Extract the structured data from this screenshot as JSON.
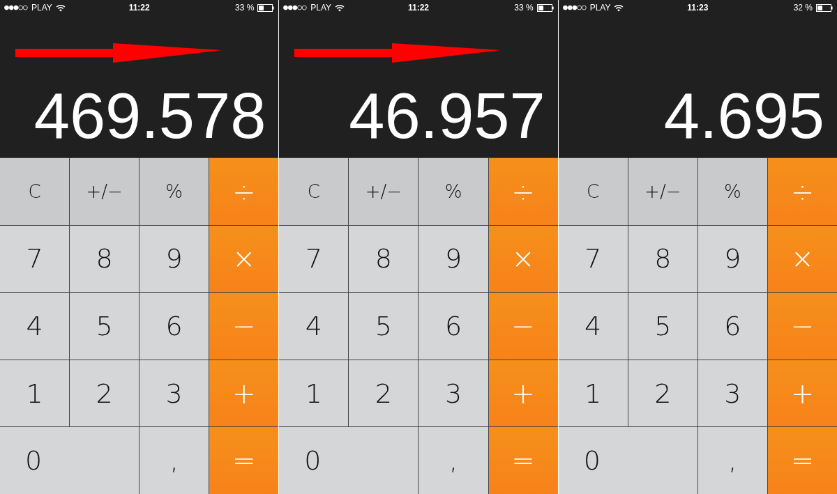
{
  "panels": [
    {
      "status_bar": {
        "carrier": "PLAY",
        "time": "11:22",
        "battery": "33 %"
      },
      "display": "469.578",
      "arrow_overlay": true,
      "keys": [
        {
          "label": "C",
          "kind": "function"
        },
        {
          "label": "+/−",
          "kind": "function"
        },
        {
          "label": "%",
          "kind": "function"
        },
        {
          "label": "÷",
          "kind": "operator"
        },
        {
          "label": "7",
          "kind": "digit"
        },
        {
          "label": "8",
          "kind": "digit"
        },
        {
          "label": "9",
          "kind": "digit"
        },
        {
          "label": "×",
          "kind": "operator"
        },
        {
          "label": "4",
          "kind": "digit"
        },
        {
          "label": "5",
          "kind": "digit"
        },
        {
          "label": "6",
          "kind": "digit"
        },
        {
          "label": "−",
          "kind": "operator"
        },
        {
          "label": "1",
          "kind": "digit"
        },
        {
          "label": "2",
          "kind": "digit"
        },
        {
          "label": "3",
          "kind": "digit"
        },
        {
          "label": "+",
          "kind": "operator"
        },
        {
          "label": "0",
          "kind": "wide"
        },
        {
          "label": ",",
          "kind": "digit"
        },
        {
          "label": "=",
          "kind": "operator"
        }
      ]
    },
    {
      "status_bar": {
        "carrier": "PLAY",
        "time": "11:22",
        "battery": "33 %"
      },
      "display": "46.957",
      "arrow_overlay": true,
      "keys": [
        {
          "label": "C",
          "kind": "function"
        },
        {
          "label": "+/−",
          "kind": "function"
        },
        {
          "label": "%",
          "kind": "function"
        },
        {
          "label": "÷",
          "kind": "operator"
        },
        {
          "label": "7",
          "kind": "digit"
        },
        {
          "label": "8",
          "kind": "digit"
        },
        {
          "label": "9",
          "kind": "digit"
        },
        {
          "label": "×",
          "kind": "operator"
        },
        {
          "label": "4",
          "kind": "digit"
        },
        {
          "label": "5",
          "kind": "digit"
        },
        {
          "label": "6",
          "kind": "digit"
        },
        {
          "label": "−",
          "kind": "operator"
        },
        {
          "label": "1",
          "kind": "digit"
        },
        {
          "label": "2",
          "kind": "digit"
        },
        {
          "label": "3",
          "kind": "digit"
        },
        {
          "label": "+",
          "kind": "operator"
        },
        {
          "label": "0",
          "kind": "wide"
        },
        {
          "label": ",",
          "kind": "digit"
        },
        {
          "label": "=",
          "kind": "operator"
        }
      ]
    },
    {
      "status_bar": {
        "carrier": "PLAY",
        "time": "11:23",
        "battery": "32 %"
      },
      "display": "4.695",
      "arrow_overlay": false,
      "keys": [
        {
          "label": "C",
          "kind": "function"
        },
        {
          "label": "+/−",
          "kind": "function"
        },
        {
          "label": "%",
          "kind": "function"
        },
        {
          "label": "÷",
          "kind": "operator"
        },
        {
          "label": "7",
          "kind": "digit"
        },
        {
          "label": "8",
          "kind": "digit"
        },
        {
          "label": "9",
          "kind": "digit"
        },
        {
          "label": "×",
          "kind": "operator"
        },
        {
          "label": "4",
          "kind": "digit"
        },
        {
          "label": "5",
          "kind": "digit"
        },
        {
          "label": "6",
          "kind": "digit"
        },
        {
          "label": "−",
          "kind": "operator"
        },
        {
          "label": "1",
          "kind": "digit"
        },
        {
          "label": "2",
          "kind": "digit"
        },
        {
          "label": "3",
          "kind": "digit"
        },
        {
          "label": "+",
          "kind": "operator"
        },
        {
          "label": "0",
          "kind": "wide"
        },
        {
          "label": ",",
          "kind": "digit"
        },
        {
          "label": "=",
          "kind": "operator"
        }
      ]
    }
  ]
}
